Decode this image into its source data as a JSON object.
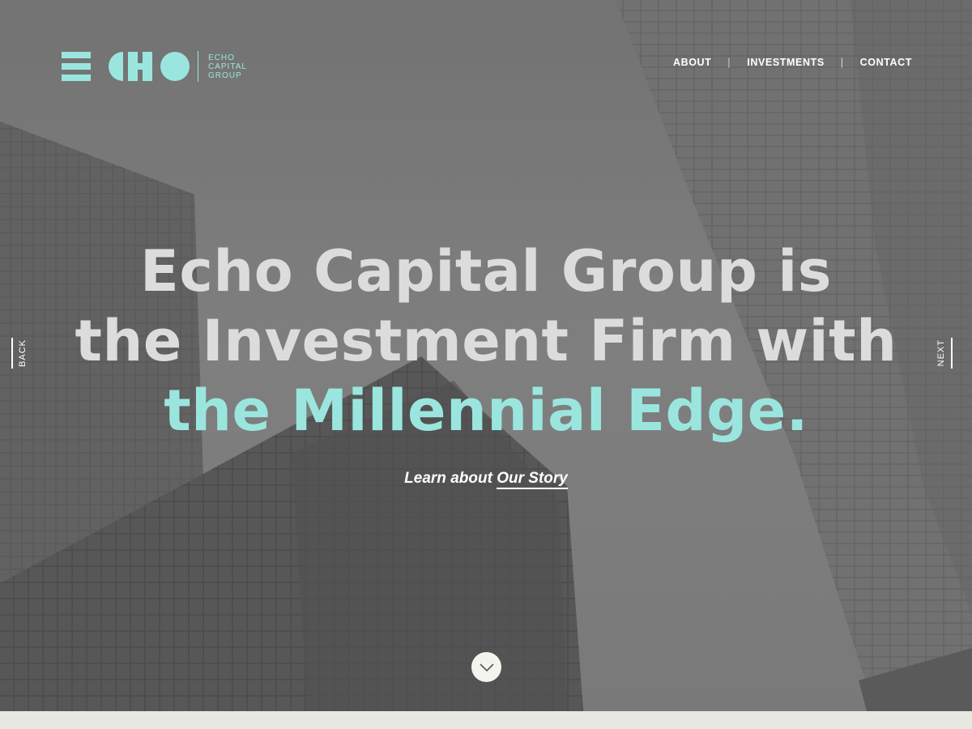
{
  "brand": {
    "logo_text_line1": "ECHO",
    "logo_text_line2": "CAPITAL",
    "logo_text_line3": "GROUP",
    "accent_color": "#9ae6df"
  },
  "nav": {
    "items": [
      {
        "label": "ABOUT"
      },
      {
        "label": "INVESTMENTS"
      },
      {
        "label": "CONTACT"
      }
    ],
    "separator": "|"
  },
  "slider": {
    "back_label": "BACK",
    "next_label": "NEXT"
  },
  "hero": {
    "headline_line1": "Echo Capital Group is",
    "headline_line2": "the Investment Firm with",
    "headline_line3": "the Millennial Edge.",
    "story_prefix": "Learn about",
    "story_link": "Our Story"
  },
  "icons": {
    "scroll": "chevron-down-icon"
  }
}
